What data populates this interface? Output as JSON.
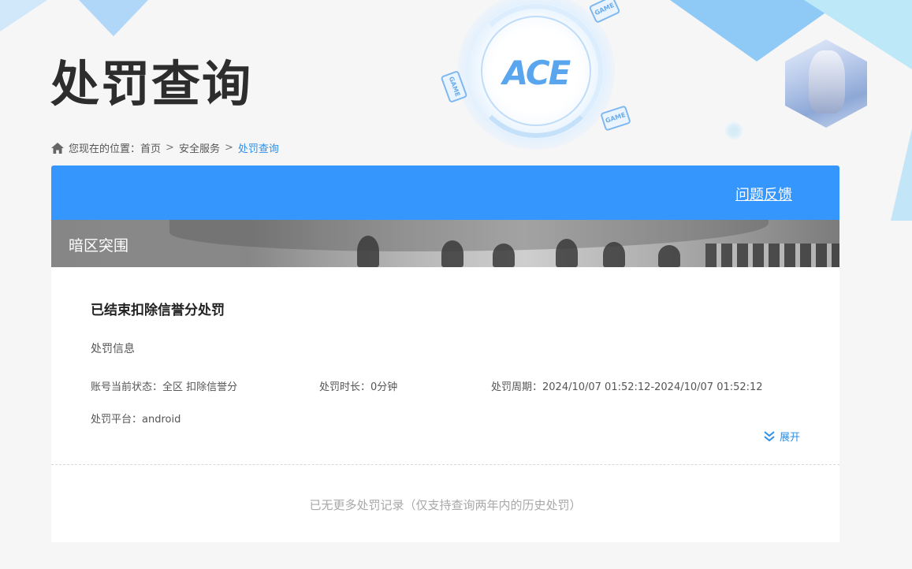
{
  "page": {
    "title": "处罚查询"
  },
  "decor": {
    "logo_text": "ACE",
    "game_tag": "GAME"
  },
  "breadcrumb": {
    "prefix": "您现在的位置：",
    "items": [
      "首页",
      "安全服务"
    ],
    "current": "处罚查询",
    "separator": ">"
  },
  "card": {
    "feedback_label": "问题反馈",
    "game_name": "暗区突围",
    "record": {
      "title": "已结束扣除信誉分处罚",
      "section_label": "处罚信息",
      "account_status": "账号当前状态：全区 扣除信誉分",
      "duration": "处罚时长：0分钟",
      "period": "处罚周期：2024/10/07 01:52:12-2024/10/07 01:52:12",
      "platform": "处罚平台：android",
      "expand_label": "展开"
    },
    "no_more_text": "已无更多处罚记录（仅支持查询两年内的历史处罚）"
  },
  "colors": {
    "accent": "#3596fd",
    "link": "#2f8fe6",
    "title": "#2d2d2d",
    "muted": "#a8a8a8"
  },
  "icons": {
    "breadcrumb": "home-icon",
    "expand": "chevron-double-down-icon"
  }
}
